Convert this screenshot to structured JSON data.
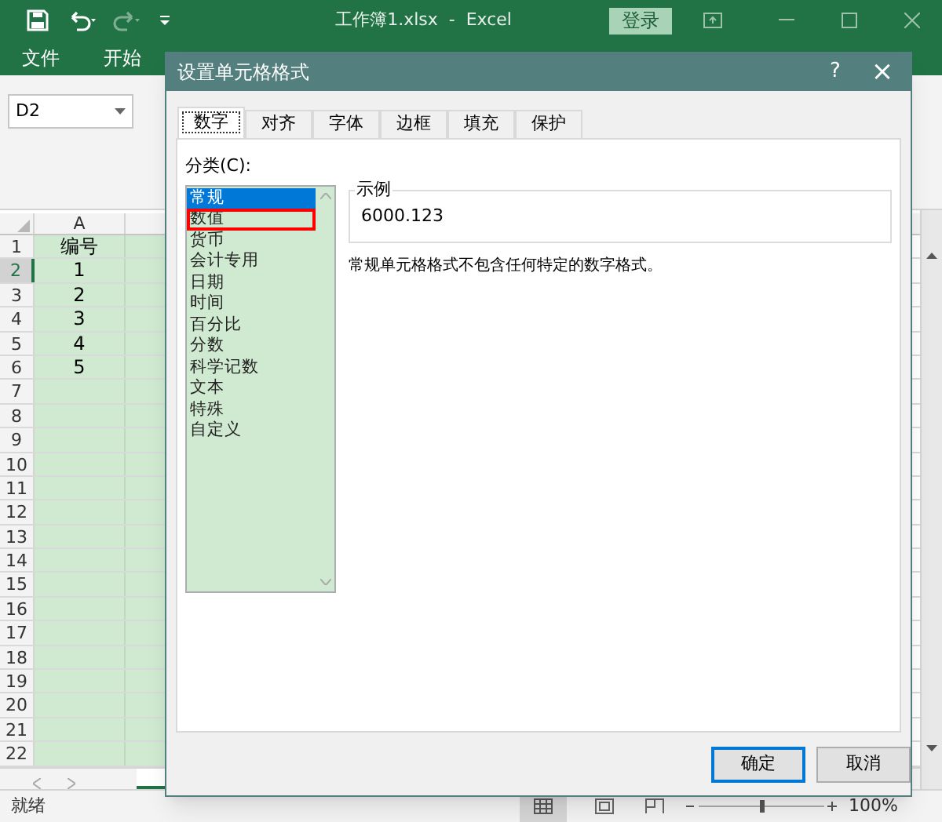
{
  "title_bar": {
    "title": "工作簿1.xlsx  -  Excel",
    "login": "登录"
  },
  "ribbon_tabs": [
    "文件",
    "开始"
  ],
  "name_box": "D2",
  "sheet": {
    "columns": [
      "A"
    ],
    "rows": [
      {
        "number": "1",
        "cells": [
          "编号"
        ],
        "selected": false
      },
      {
        "number": "2",
        "cells": [
          "1"
        ],
        "selected": true
      },
      {
        "number": "3",
        "cells": [
          "2"
        ],
        "selected": false
      },
      {
        "number": "4",
        "cells": [
          "3"
        ],
        "selected": false
      },
      {
        "number": "5",
        "cells": [
          "4"
        ],
        "selected": false
      },
      {
        "number": "6",
        "cells": [
          "5"
        ],
        "selected": false
      },
      {
        "number": "7",
        "cells": [],
        "selected": false
      },
      {
        "number": "8",
        "cells": [],
        "selected": false
      },
      {
        "number": "9",
        "cells": [],
        "selected": false
      },
      {
        "number": "10",
        "cells": [],
        "selected": false
      },
      {
        "number": "11",
        "cells": [],
        "selected": false
      },
      {
        "number": "12",
        "cells": [],
        "selected": false
      },
      {
        "number": "13",
        "cells": [],
        "selected": false
      },
      {
        "number": "14",
        "cells": [],
        "selected": false
      },
      {
        "number": "15",
        "cells": [],
        "selected": false
      },
      {
        "number": "16",
        "cells": [],
        "selected": false
      },
      {
        "number": "17",
        "cells": [],
        "selected": false
      },
      {
        "number": "18",
        "cells": [],
        "selected": false
      },
      {
        "number": "19",
        "cells": [],
        "selected": false
      },
      {
        "number": "20",
        "cells": [],
        "selected": false
      },
      {
        "number": "21",
        "cells": [],
        "selected": false
      },
      {
        "number": "22",
        "cells": [],
        "selected": false
      }
    ]
  },
  "status_bar": {
    "text": "就绪",
    "zoom": "100%"
  },
  "dialog": {
    "title": "设置单元格格式",
    "help": "?",
    "close": "×",
    "tabs": [
      {
        "label": "数字",
        "selected": true
      },
      {
        "label": "对齐",
        "selected": false
      },
      {
        "label": "字体",
        "selected": false
      },
      {
        "label": "边框",
        "selected": false
      },
      {
        "label": "填充",
        "selected": false
      },
      {
        "label": "保护",
        "selected": false
      }
    ],
    "category_label": "分类(C):",
    "categories": [
      {
        "label": "常规",
        "selected": true,
        "highlighted": false
      },
      {
        "label": "数值",
        "selected": false,
        "highlighted": true
      },
      {
        "label": "货币",
        "selected": false,
        "highlighted": false
      },
      {
        "label": "会计专用",
        "selected": false,
        "highlighted": false
      },
      {
        "label": "日期",
        "selected": false,
        "highlighted": false
      },
      {
        "label": "时间",
        "selected": false,
        "highlighted": false
      },
      {
        "label": "百分比",
        "selected": false,
        "highlighted": false
      },
      {
        "label": "分数",
        "selected": false,
        "highlighted": false
      },
      {
        "label": "科学记数",
        "selected": false,
        "highlighted": false
      },
      {
        "label": "文本",
        "selected": false,
        "highlighted": false
      },
      {
        "label": "特殊",
        "selected": false,
        "highlighted": false
      },
      {
        "label": "自定义",
        "selected": false,
        "highlighted": false
      }
    ],
    "sample": {
      "label": "示例",
      "value": "6000.123"
    },
    "description": "常规单元格格式不包含任何特定的数字格式。",
    "buttons": [
      {
        "label": "确定",
        "default": true
      },
      {
        "label": "取消",
        "default": false
      }
    ]
  }
}
